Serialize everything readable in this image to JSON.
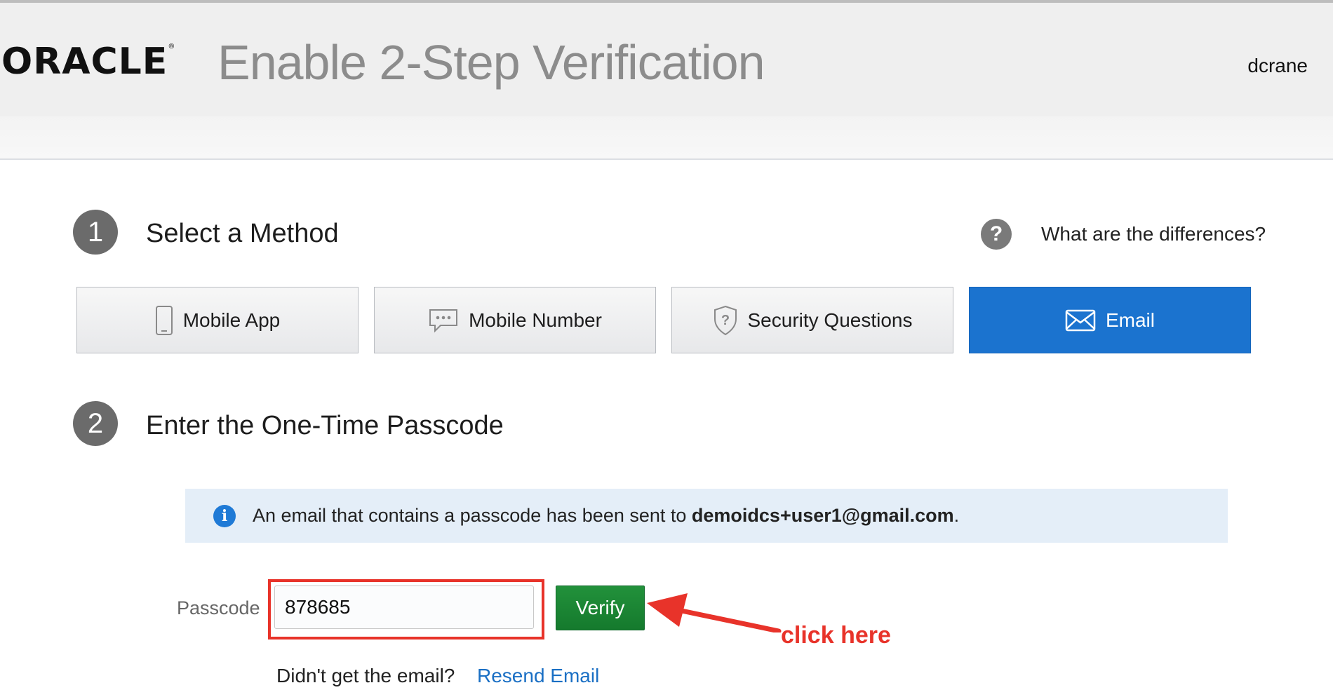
{
  "header": {
    "logo": "ORACLE",
    "title": "Enable 2-Step Verification",
    "username": "dcrane"
  },
  "step1": {
    "number": "1",
    "title": "Select a Method",
    "help_link": "What are the differences?",
    "methods": [
      {
        "label": "Mobile App",
        "icon": "mobile-phone-icon",
        "active": false
      },
      {
        "label": "Mobile Number",
        "icon": "sms-bubble-icon",
        "active": false
      },
      {
        "label": "Security Questions",
        "icon": "shield-question-icon",
        "active": false
      },
      {
        "label": "Email",
        "icon": "envelope-icon",
        "active": true
      }
    ]
  },
  "step2": {
    "number": "2",
    "title": "Enter the One-Time Passcode",
    "info_prefix": "An email that contains a passcode has been sent to ",
    "info_email": "demoidcs+user1@gmail.com",
    "info_suffix": ".",
    "passcode_label": "Passcode",
    "passcode_value": "878685",
    "verify_label": "Verify",
    "resend_prompt": "Didn't get the email?",
    "resend_link": "Resend Email"
  },
  "annotation": {
    "callout": "click here",
    "color": "#e8332a"
  },
  "colors": {
    "accent": "#1b73cf",
    "verify": "#1a8435"
  }
}
